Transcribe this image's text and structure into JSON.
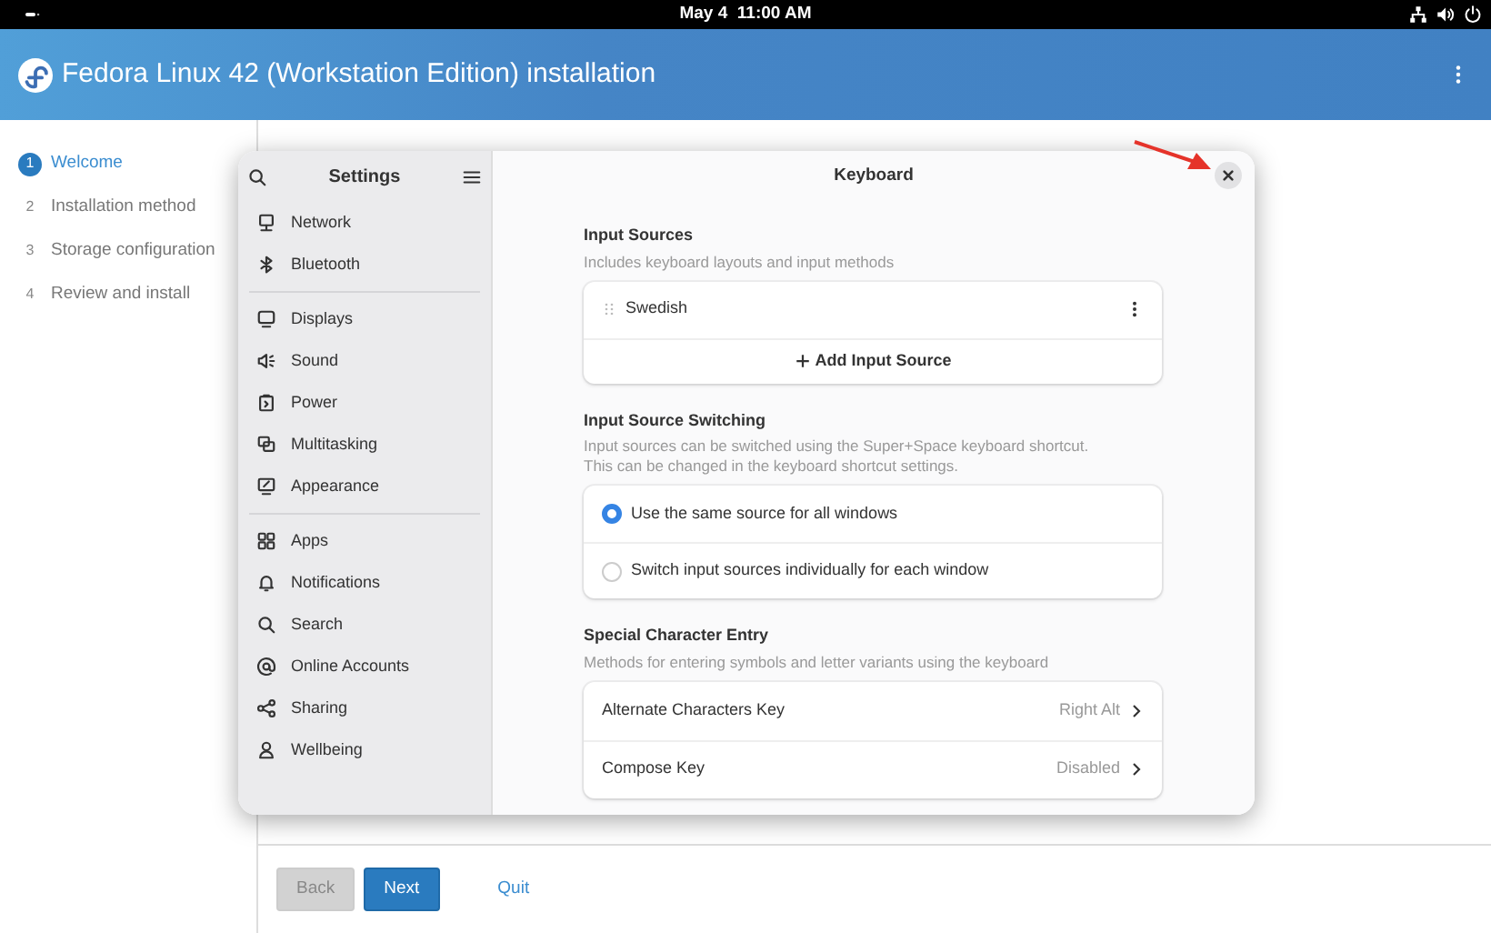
{
  "top_bar": {
    "clock": "May 4  11:00 AM"
  },
  "header": {
    "title": "Fedora Linux 42 (Workstation Edition) installation"
  },
  "steps": [
    {
      "number": "1",
      "label": "Welcome",
      "selected": true
    },
    {
      "number": "2",
      "label": "Installation method",
      "selected": false
    },
    {
      "number": "3",
      "label": "Storage configuration",
      "selected": false
    },
    {
      "number": "4",
      "label": "Review and install",
      "selected": false
    }
  ],
  "settings_window": {
    "sidebar": {
      "title": "Settings",
      "groups": [
        [
          "Network",
          "Bluetooth"
        ],
        [
          "Displays",
          "Sound",
          "Power",
          "Multitasking",
          "Appearance"
        ],
        [
          "Apps",
          "Notifications",
          "Search",
          "Online Accounts",
          "Sharing",
          "Wellbeing"
        ]
      ]
    },
    "page": {
      "title": "Keyboard",
      "input_sources": {
        "title": "Input Sources",
        "subtitle": "Includes keyboard layouts and input methods",
        "sources": [
          "Swedish"
        ],
        "add_label": "Add Input Source"
      },
      "switching": {
        "title": "Input Source Switching",
        "subtitle_lines": [
          "Input sources can be switched using the Super+Space keyboard shortcut.",
          "This can be changed in the keyboard shortcut settings."
        ],
        "options": [
          {
            "label": "Use the same source for all windows",
            "selected": true
          },
          {
            "label": "Switch input sources individually for each window",
            "selected": false
          }
        ]
      },
      "special": {
        "title": "Special Character Entry",
        "subtitle": "Methods for entering symbols and letter variants using the keyboard",
        "rows": [
          {
            "label": "Alternate Characters Key",
            "value": "Right Alt"
          },
          {
            "label": "Compose Key",
            "value": "Disabled"
          }
        ]
      }
    }
  },
  "footer": {
    "buttons": [
      {
        "label": "Back",
        "kind": "secondary",
        "disabled": true
      },
      {
        "label": "Next",
        "kind": "primary",
        "disabled": false
      },
      {
        "label": "Quit",
        "kind": "link",
        "disabled": false
      }
    ]
  }
}
